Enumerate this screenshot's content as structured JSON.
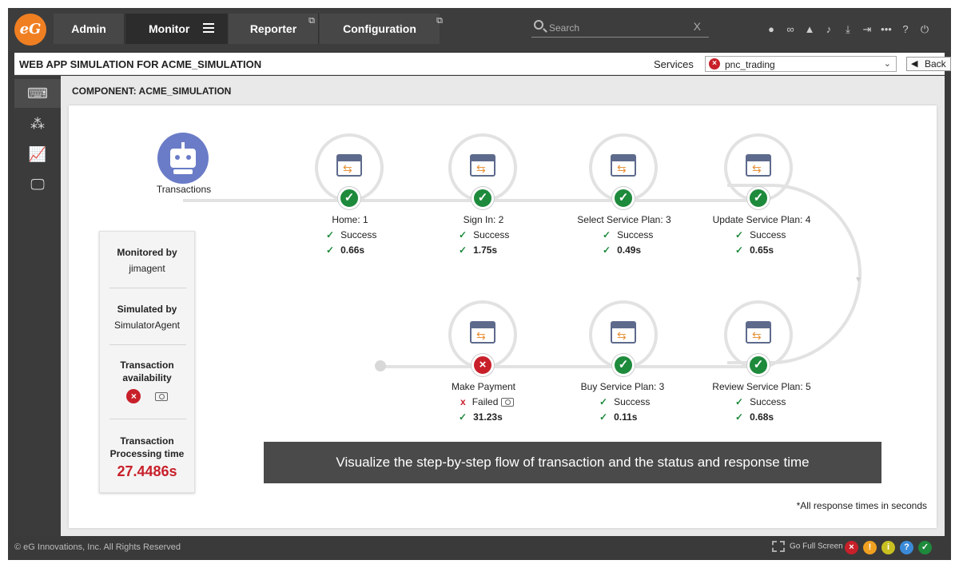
{
  "nav": {
    "tabs": [
      {
        "label": "Admin"
      },
      {
        "label": "Monitor"
      },
      {
        "label": "Reporter"
      },
      {
        "label": "Configuration"
      }
    ],
    "search_placeholder": "Search",
    "logo_text": "eG"
  },
  "header": {
    "title": "WEB APP SIMULATION FOR ACME_SIMULATION",
    "services_label": "Services",
    "selected_service": "pnc_trading",
    "back_label": "Back"
  },
  "component_label": "COMPONENT: ACME_SIMULATION",
  "transactions_label": "Transactions",
  "steps": [
    {
      "name": "Home: 1",
      "status": "Success",
      "time": "0.66s",
      "ok": true
    },
    {
      "name": "Sign In: 2",
      "status": "Success",
      "time": "1.75s",
      "ok": true
    },
    {
      "name": "Select Service Plan: 3",
      "status": "Success",
      "time": "0.49s",
      "ok": true
    },
    {
      "name": "Update Service Plan: 4",
      "status": "Success",
      "time": "0.65s",
      "ok": true
    },
    {
      "name": "Review Service Plan: 5",
      "status": "Success",
      "time": "0.68s",
      "ok": true
    },
    {
      "name": "Buy Service Plan: 3",
      "status": "Success",
      "time": "0.11s",
      "ok": true
    },
    {
      "name": "Make Payment",
      "status": "Failed",
      "time": "31.23s",
      "ok": false
    }
  ],
  "info": {
    "monitored_by_label": "Monitored by",
    "monitored_by_value": "jimagent",
    "simulated_by_label": "Simulated by",
    "simulated_by_value": "SimulatorAgent",
    "availability_label": "Transaction availability",
    "processing_label": "Transaction Processing time",
    "processing_value": "27.4486s"
  },
  "banner": "Visualize the step-by-step flow of transaction and the status and response time",
  "footnote": "*All response times in seconds",
  "footer": {
    "copyright": "© eG Innovations, Inc. All Rights Reserved",
    "fullscreen": "Go Full Screen"
  },
  "colors": {
    "success": "#1e8a3c",
    "failure": "#c8202a",
    "warning": "#f0a020",
    "info": "#c8c020",
    "help": "#3a8ad8",
    "brand": "#f07f22"
  }
}
